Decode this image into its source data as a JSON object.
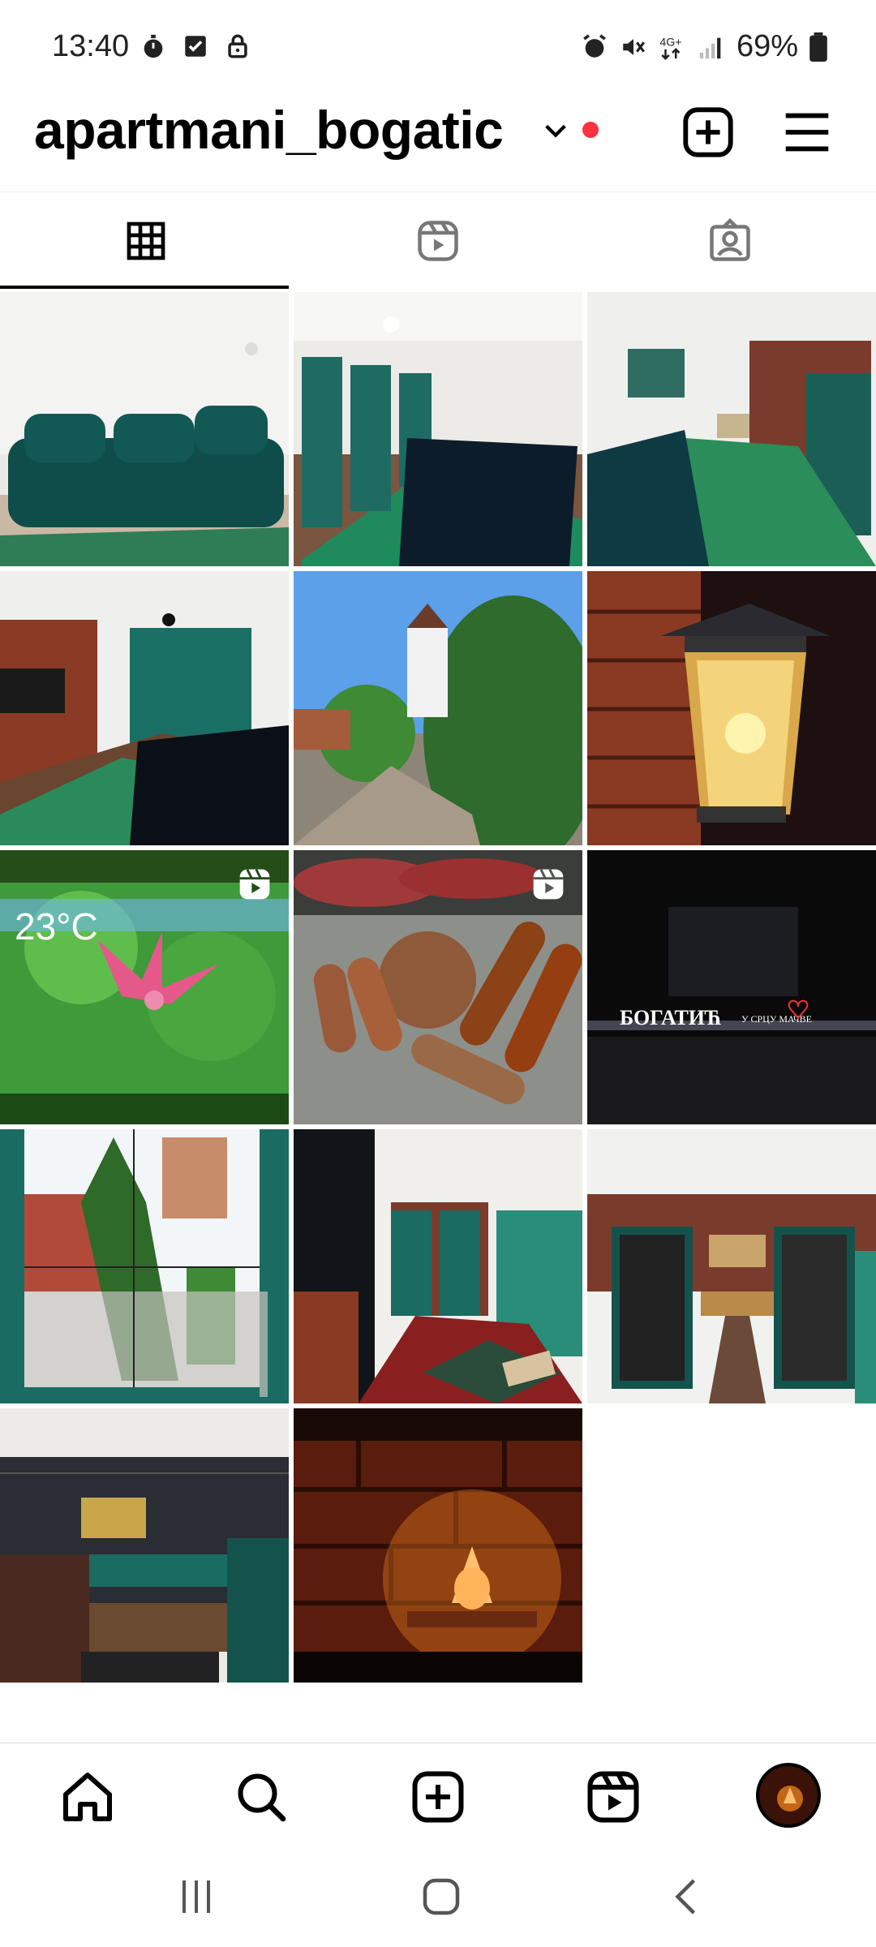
{
  "status_bar": {
    "time": "13:40",
    "network": "4G+",
    "battery": "69%",
    "left_icons": [
      "stopwatch-icon",
      "task-check-icon",
      "lock-icon"
    ],
    "right_icons": [
      "alarm-icon",
      "mute-icon",
      "network-icon",
      "signal-icon",
      "battery-icon"
    ]
  },
  "header": {
    "username": "apartmani_bogatic",
    "has_notification": true,
    "notification_color": "#ff3040"
  },
  "profile_tabs": [
    {
      "name": "grid",
      "icon": "grid-icon",
      "active": true
    },
    {
      "name": "reels",
      "icon": "reels-icon",
      "active": false
    },
    {
      "name": "tagged",
      "icon": "tagged-icon",
      "active": false
    }
  ],
  "posts": [
    {
      "subject": "green velvet sofa",
      "is_reel": false
    },
    {
      "subject": "living room with sofa and green doors",
      "is_reel": false
    },
    {
      "subject": "room with sofa and window",
      "is_reel": false
    },
    {
      "subject": "room with brick wall and TV",
      "is_reel": false
    },
    {
      "subject": "garden with hedge",
      "is_reel": false
    },
    {
      "subject": "lantern at night",
      "is_reel": false
    },
    {
      "subject": "flower",
      "is_reel": true,
      "overlay_text": "23°C"
    },
    {
      "subject": "grilled sausages",
      "is_reel": true
    },
    {
      "subject": "town sign at night",
      "is_reel": false,
      "overlay_text": "БОГАТИЋ",
      "overlay_text_2": "У СРЦУ МАЧВЕ"
    },
    {
      "subject": "yard view through window",
      "is_reel": false
    },
    {
      "subject": "kitchen with green cabinets",
      "is_reel": false
    },
    {
      "subject": "kitchen hallway",
      "is_reel": false
    },
    {
      "subject": "bunk bed room",
      "is_reel": false
    },
    {
      "subject": "salt lamp by brick wall",
      "is_reel": false
    }
  ],
  "bottom_nav": [
    {
      "name": "home",
      "icon": "home-icon"
    },
    {
      "name": "search",
      "icon": "search-icon"
    },
    {
      "name": "create",
      "icon": "plus-square-icon"
    },
    {
      "name": "reels",
      "icon": "reels-icon"
    },
    {
      "name": "profile",
      "icon": "avatar"
    }
  ],
  "system_nav": [
    "recent-apps-icon",
    "home-button-icon",
    "back-icon"
  ],
  "colors": {
    "accent": "#000000",
    "notification": "#ff3040",
    "teal": "#0f5b52"
  }
}
